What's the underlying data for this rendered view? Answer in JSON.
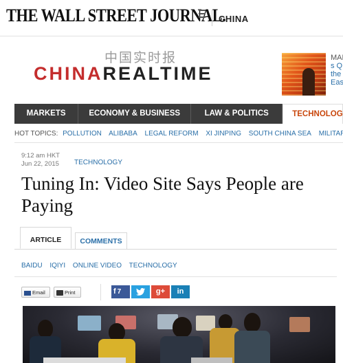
{
  "masthead": {
    "logo": "THE WALL STREET JOURNAL.",
    "edition": "CHINA"
  },
  "blog": {
    "chinese_title": "中国实时报",
    "title_part1": "CHINA",
    "title_part2": "REALTIME"
  },
  "promo": {
    "text_line1": "MAR",
    "text_line2": "s Q",
    "text_line3": "the",
    "text_line4": "East"
  },
  "nav": {
    "items": [
      "MARKETS",
      "ECONOMY & BUSINESS",
      "LAW & POLITICS",
      "TECHNOLOGY"
    ]
  },
  "hot_topics": {
    "label": "HOT TOPICS:",
    "items": [
      "POLLUTION",
      "ALIBABA",
      "LEGAL REFORM",
      "XI JINPING",
      "SOUTH CHINA SEA",
      "MILITARY"
    ]
  },
  "article": {
    "time": "9:12 am HKT",
    "date": "Jun 22, 2015",
    "category": "TECHNOLOGY",
    "headline": "Tuning In: Video Site Says People are Paying"
  },
  "tabs": {
    "article": "ARTICLE",
    "comments": "COMMENTS"
  },
  "tags": [
    "BAIDU",
    "IQIYI",
    "ONLINE VIDEO",
    "TECHNOLOGY"
  ],
  "share": {
    "email": "Email",
    "print": "Print",
    "facebook_count": "7",
    "twitter_icon": "twitter-icon",
    "googleplus_label": "g+",
    "linkedin_label": "in"
  },
  "colors": {
    "brand_red": "#c42d2d",
    "nav_dark": "#3b3b3b",
    "nav_active": "#c9480e",
    "link_blue": "#2a6fa8"
  }
}
